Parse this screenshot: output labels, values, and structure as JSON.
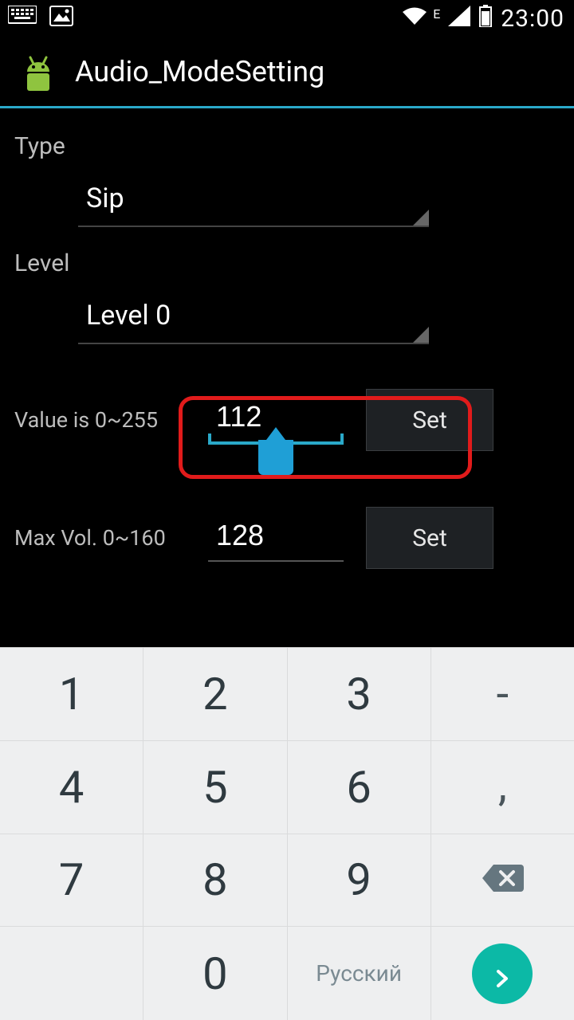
{
  "statusbar": {
    "network_type": "E",
    "time": "23:00",
    "icons": {
      "keyboard": "keyboard-icon",
      "image": "image-icon",
      "wifi": "wifi-icon",
      "cell": "cell-signal-icon",
      "battery": "battery-icon"
    }
  },
  "appbar": {
    "title": "Audio_ModeSetting",
    "accent_color": "#2aa9c9"
  },
  "form": {
    "type_label": "Type",
    "type_value": "Sip",
    "level_label": "Level",
    "level_value": "Level 0",
    "value_row": {
      "label": "Value is 0~255",
      "value": "112",
      "button": "Set"
    },
    "maxvol_row": {
      "label": "Max Vol. 0~160",
      "value": "128",
      "button": "Set"
    }
  },
  "keyboard": {
    "rows": [
      [
        "1",
        "2",
        "3",
        "-"
      ],
      [
        "4",
        "5",
        "6",
        ","
      ],
      [
        "7",
        "8",
        "9",
        "backspace"
      ],
      [
        "",
        "0",
        "Русский",
        "enter"
      ]
    ],
    "language_label": "Русский"
  }
}
